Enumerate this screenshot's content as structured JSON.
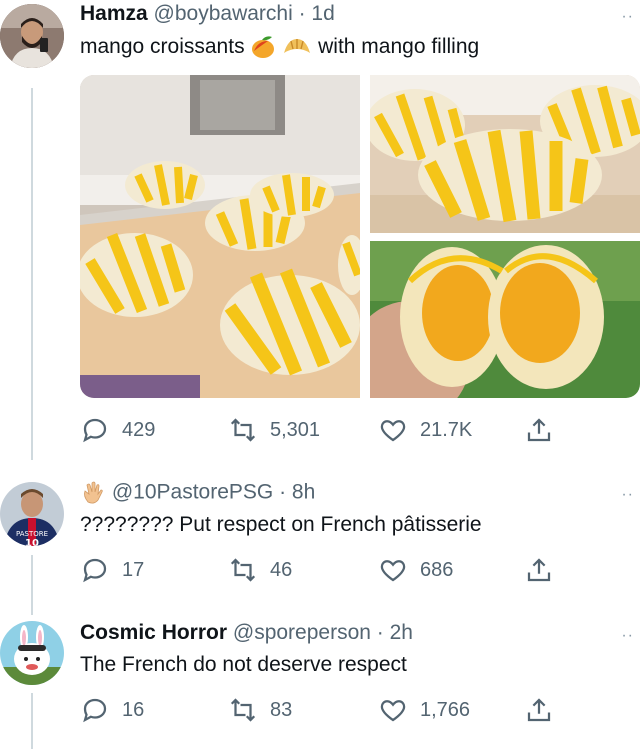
{
  "tweet": {
    "author_name": "Hamza",
    "handle_time": "@boybawarchi · 1d",
    "text_before": "mango croissants",
    "emoji_names": [
      "mango-icon",
      "croissant-icon"
    ],
    "text_after": "with mango filling",
    "replies": "429",
    "retweets": "5,301",
    "likes": "21.7K",
    "more": "··"
  },
  "reply1": {
    "emoji_name": "waving-hand-icon",
    "handle_time": "@10PastorePSG · 8h",
    "text": "???????? Put respect on French pâtisserie",
    "replies": "17",
    "retweets": "46",
    "likes": "686",
    "more": "··",
    "jersey_text": "PASTORE",
    "jersey_number": "10"
  },
  "reply2": {
    "author_name": "Cosmic Horror",
    "handle_time": "@sporeperson · 2h",
    "text": "The French do not deserve respect",
    "replies": "16",
    "retweets": "83",
    "likes": "1,766",
    "more": "··"
  },
  "colors": {
    "text": "#0f1419",
    "secondary": "#536471",
    "thread_line": "#cfd9de",
    "mango": "#f5c518",
    "pastry": "#f3ead2"
  }
}
